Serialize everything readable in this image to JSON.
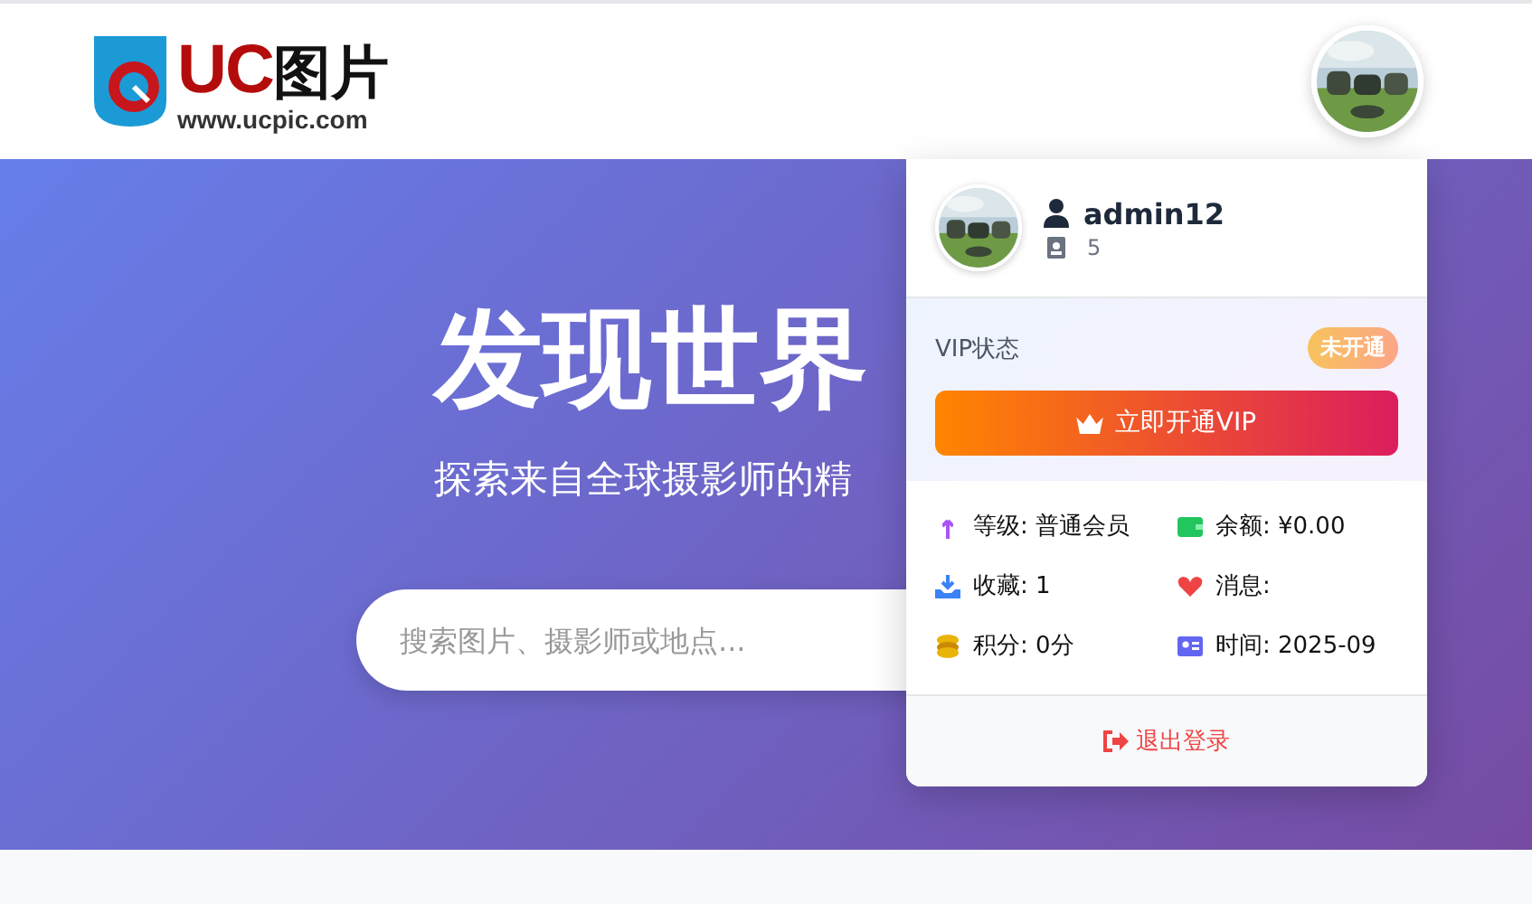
{
  "header": {
    "logo": {
      "mark": "UC",
      "name": "图片",
      "url": "www.ucpic.com"
    }
  },
  "hero": {
    "title": "发现世界",
    "subtitle": "探索来自全球摄影师的精",
    "search": {
      "placeholder": "搜索图片、摄影师或地点..."
    }
  },
  "user_menu": {
    "username": "admin12",
    "user_id": "5",
    "vip_label": "VIP状态",
    "vip_badge": "未开通",
    "vip_button": "立即开通VIP",
    "stats": [
      {
        "kind": "level",
        "text": "等级: 普通会员"
      },
      {
        "kind": "balance",
        "text": "余额: ¥0.00"
      },
      {
        "kind": "favorites",
        "text": "收藏: 1"
      },
      {
        "kind": "messages",
        "text": "消息:"
      },
      {
        "kind": "points",
        "text": "积分: 0分"
      },
      {
        "kind": "time",
        "text": "时间: 2025-09"
      }
    ],
    "logout": "退出登录"
  }
}
